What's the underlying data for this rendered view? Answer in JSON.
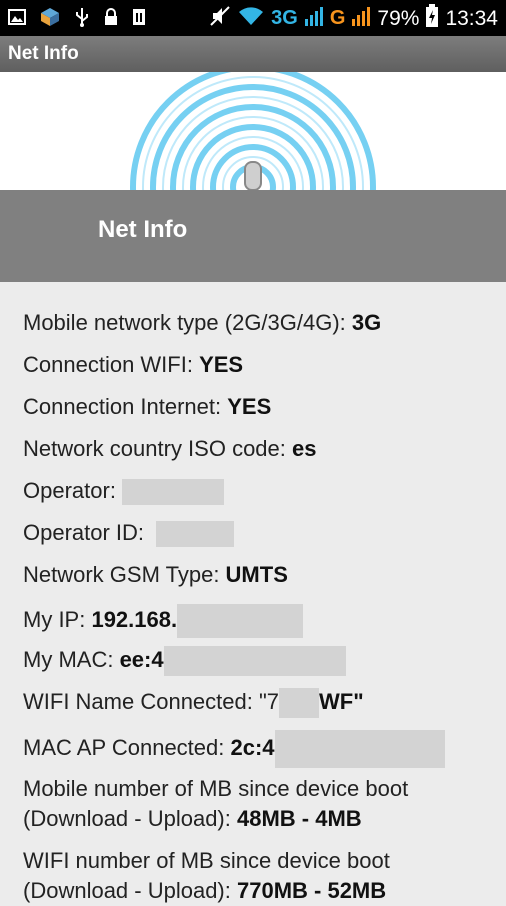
{
  "status_bar": {
    "icons_left": [
      "image-icon",
      "app-icon",
      "usb-icon",
      "lock-icon",
      "sim-icon"
    ],
    "network_3g": "3G",
    "network_g": "G",
    "battery": "79%",
    "time": "13:34"
  },
  "app_bar": {
    "title": "Net Info"
  },
  "header": {
    "title": "Net Info"
  },
  "info": {
    "mobile_network_type": {
      "label": "Mobile network type (2G/3G/4G): ",
      "value": "3G"
    },
    "connection_wifi": {
      "label": "Connection WIFI: ",
      "value": "YES"
    },
    "connection_internet": {
      "label": "Connection Internet: ",
      "value": "YES"
    },
    "country_iso": {
      "label": "Network country ISO code: ",
      "value": "es"
    },
    "operator": {
      "label": "Operator: "
    },
    "operator_id": {
      "label": "Operator ID: "
    },
    "gsm_type": {
      "label": "Network GSM Type: ",
      "value": "UMTS"
    },
    "my_ip": {
      "label": "My IP: ",
      "value": "192.168."
    },
    "my_mac": {
      "label": "My MAC: ",
      "value": "ee:4"
    },
    "wifi_name": {
      "label": "WIFI Name Connected: ",
      "prefix": "\"7",
      "suffix": "WF\""
    },
    "mac_ap": {
      "label": "MAC AP Connected: ",
      "value": "2c:4"
    },
    "mobile_mb": {
      "line1": "Mobile number of MB since device boot",
      "line2_label": "(Download - Upload): ",
      "value": "48MB - 4MB"
    },
    "wifi_mb": {
      "line1": "WIFI number of MB since device boot",
      "line2_label": "(Download - Upload): ",
      "value": "770MB - 52MB"
    }
  },
  "colors": {
    "status_bg": "#000000",
    "appbar": "#6e6e6e",
    "header": "#808080",
    "content_bg": "#ececec",
    "wifi_blue": "#33b5e5",
    "signal_orange": "#f7941d"
  }
}
